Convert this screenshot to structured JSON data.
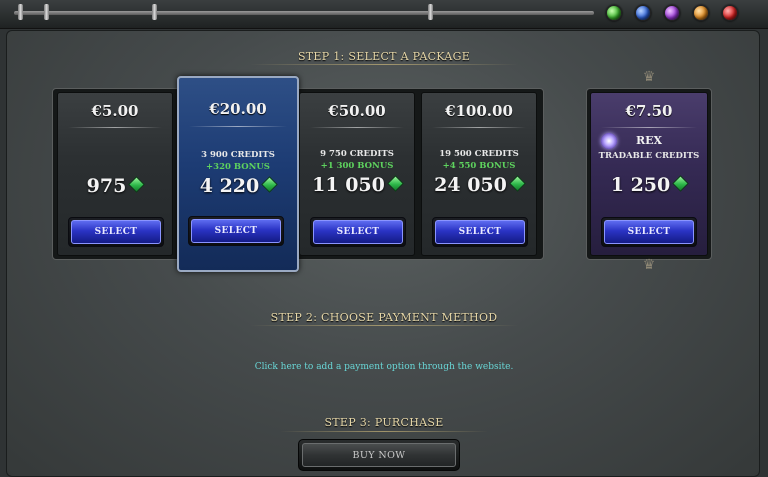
{
  "colors": {
    "accent_gold": "#e6d7a8",
    "bonus_green": "#5ed35e",
    "link_cyan": "#69d6d6",
    "selected_blue": "#1d3c74",
    "button_blue": "#2a33c4"
  },
  "topbar": {
    "gems": [
      "green-gem-icon",
      "blue-gem-icon",
      "purple-gem-icon",
      "orange-gem-icon",
      "red-gem-icon"
    ]
  },
  "step1": {
    "title": "STEP 1: SELECT A PACKAGE",
    "select_label": "SELECT",
    "packages": [
      {
        "price": "€5.00",
        "credits": "",
        "bonus": "",
        "total": "975",
        "selected": false
      },
      {
        "price": "€20.00",
        "credits": "3 900 CREDITS",
        "bonus": "+320 BONUS",
        "total": "4 220",
        "selected": true
      },
      {
        "price": "€50.00",
        "credits": "9 750 CREDITS",
        "bonus": "+1 300 BONUS",
        "total": "11 050",
        "selected": false
      },
      {
        "price": "€100.00",
        "credits": "19 500 CREDITS",
        "bonus": "+4 550 BONUS",
        "total": "24 050",
        "selected": false
      }
    ],
    "rex": {
      "price": "€7.50",
      "title": "REX",
      "subtitle": "TRADABLE CREDITS",
      "total": "1 250"
    }
  },
  "step2": {
    "title": "STEP 2: CHOOSE PAYMENT METHOD",
    "link": "Click here to add a payment option through the website."
  },
  "step3": {
    "title": "STEP 3: PURCHASE",
    "buy_label": "BUY NOW"
  }
}
